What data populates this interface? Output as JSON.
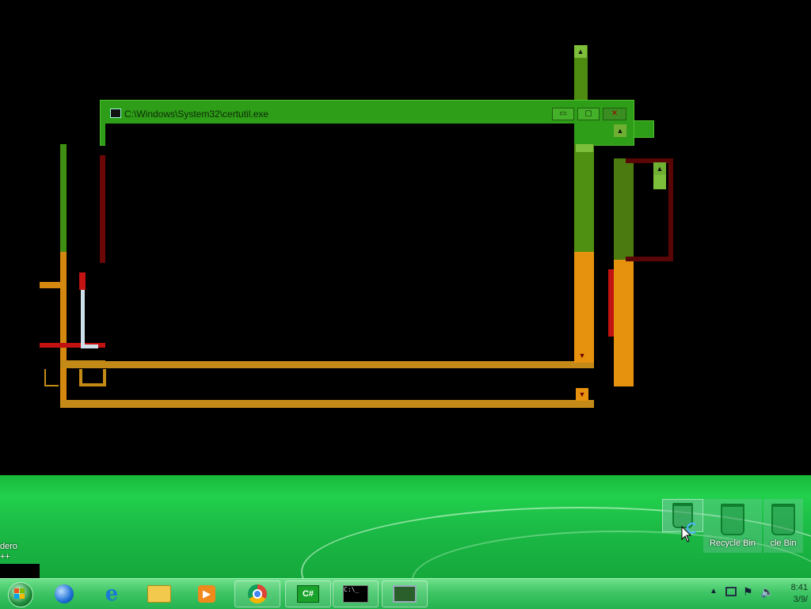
{
  "console_window": {
    "title": "C:\\Windows\\System32\\certutil.exe",
    "minimize_label": "▭",
    "maximize_label": "▢",
    "close_label": "✕"
  },
  "desktop": {
    "partial_icon_label_1": "dero",
    "partial_icon_label_2": "++",
    "recycle_bin_label": "Recycle Bin",
    "recycle_bin_partial_label": "cle Bin"
  },
  "taskbar": {
    "apps": [
      "Windows Explorer",
      "Internet Explorer",
      "File Explorer",
      "Windows Media Player",
      "Google Chrome",
      "C# Editor",
      "Command Prompt",
      "Remote Desktop"
    ],
    "csharp_label": "C#",
    "cmd_label": "C:\\_",
    "clock_time": "8:41",
    "clock_date": "3/9/"
  },
  "colors": {
    "title_bar": "#2e9d18",
    "ghost_orange": "#e6920f",
    "ghost_red": "#c21212",
    "ghost_green": "#4f8f12",
    "wallpaper": "#1bb945"
  }
}
